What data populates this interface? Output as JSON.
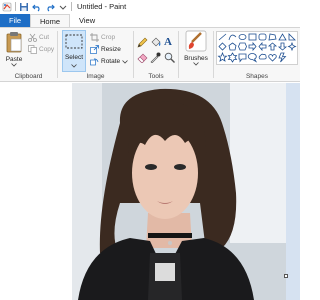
{
  "window": {
    "title": "Untitled - Paint"
  },
  "quick_access": {
    "icons": [
      "paint-app-icon",
      "save-icon",
      "undo-icon",
      "redo-icon",
      "customize-chevron-icon"
    ]
  },
  "tabs": {
    "file": "File",
    "home": "Home",
    "view": "View"
  },
  "ribbon": {
    "clipboard": {
      "label": "Clipboard",
      "paste": "Paste",
      "cut": "Cut",
      "copy": "Copy"
    },
    "image": {
      "label": "Image",
      "select": "Select",
      "crop": "Crop",
      "resize": "Resize",
      "rotate": "Rotate"
    },
    "tools": {
      "label": "Tools",
      "icons": [
        "pencil-icon",
        "fill-icon",
        "text-icon",
        "eraser-icon",
        "color-picker-icon",
        "magnifier-icon"
      ]
    },
    "brushes": {
      "label": "Brushes"
    },
    "shapes": {
      "label": "Shapes",
      "icons": [
        "line-icon",
        "curve-icon",
        "oval-icon",
        "rectangle-icon",
        "rounded-rectangle-icon",
        "polygon-icon",
        "triangle-icon",
        "right-triangle-icon",
        "diamond-icon",
        "pentagon-icon",
        "hexagon-icon",
        "right-arrow-icon",
        "left-arrow-icon",
        "up-arrow-icon",
        "down-arrow-icon",
        "four-point-star-icon",
        "five-point-star-icon",
        "six-point-star-icon",
        "rounded-callout-icon",
        "oval-callout-icon",
        "cloud-callout-icon",
        "heart-icon",
        "lightning-icon"
      ]
    }
  },
  "colors": {
    "accent": "#1e6ec6",
    "ribbon_bg": "#f7f7f7",
    "canvas_bg": "#d6e2f1",
    "select_highlight": "#cfe5fa"
  }
}
